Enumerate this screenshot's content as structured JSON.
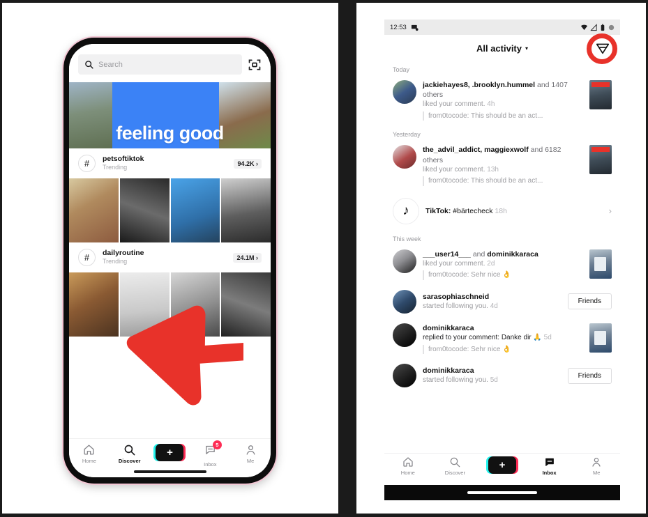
{
  "left_phone": {
    "search": {
      "placeholder": "Search",
      "icon": "search-icon",
      "scan_icon": "scan-qr-icon"
    },
    "banner": {
      "text": "feeling good"
    },
    "trending": [
      {
        "hash": "#",
        "name": "petsoftiktok",
        "subtitle": "Trending",
        "count": "94.2K",
        "chevron": "›"
      },
      {
        "hash": "#",
        "name": "dailyroutine",
        "subtitle": "Trending",
        "count": "24.1M",
        "chevron": "›"
      }
    ],
    "tabbar": [
      {
        "label": "Home",
        "icon": "home-icon",
        "active": false
      },
      {
        "label": "Discover",
        "icon": "search-icon",
        "active": false
      },
      {
        "label": "",
        "icon": "create-plus-icon",
        "active": false,
        "plus": "+"
      },
      {
        "label": "Inbox",
        "icon": "inbox-icon",
        "active": false,
        "badge": "5"
      },
      {
        "label": "Me",
        "icon": "person-icon",
        "active": false
      }
    ]
  },
  "annotations": {
    "arrow_color": "#e8322a",
    "circle_color": "#e8322a",
    "arrow_name": "red-arrow-pointing-down-left",
    "circle_name": "red-circle-highlight-send-icon"
  },
  "right_phone": {
    "statusbar": {
      "time": "12:53",
      "cast_icon": "screen-cast-icon",
      "wifi_icon": "wifi-icon",
      "signal_icon": "signal-icon",
      "battery_icon": "battery-icon"
    },
    "header": {
      "title": "All activity",
      "caret": "▾",
      "send_icon": "send-paper-plane-icon"
    },
    "sections": [
      {
        "label": "Today",
        "items": [
          {
            "type": "like",
            "avatar": "av1",
            "users": "jackiehayes8, .brooklyn.hummel",
            "and_text": " and 1407 others",
            "action": "liked your comment.",
            "time": "4h",
            "quote": "from0tocode: This should be an act...",
            "thumb": "red"
          }
        ]
      },
      {
        "label": "Yesterday",
        "items": [
          {
            "type": "like",
            "avatar": "av2",
            "users": "the_advil_addict, maggiexwolf",
            "and_text": " and 6182 others",
            "action": "liked your comment.",
            "time": "13h",
            "quote": "from0tocode: This should be an act...",
            "thumb": "red"
          },
          {
            "type": "tiktok",
            "avatar": "tiktok-logo",
            "bold": "TikTok:",
            "rest": " #bärtecheck",
            "time": "18h",
            "chevron": "›"
          }
        ]
      },
      {
        "label": "This week",
        "items": [
          {
            "type": "like",
            "avatar": "av4",
            "users": "___user14___",
            "and_text": " and ",
            "users2": "dominikkaraca",
            "action": "liked your comment.",
            "time": "2d",
            "quote": "from0tocode: Sehr nice 👌",
            "thumb": "book"
          },
          {
            "type": "follow",
            "avatar": "av5",
            "users": "sarasophiaschneid",
            "action": "started following you.",
            "time": "4d",
            "button": "Friends"
          },
          {
            "type": "reply",
            "avatar": "av6",
            "users": "dominikkaraca",
            "action": "replied to your comment: Danke dir 🙏",
            "time": "5d",
            "quote": "from0tocode: Sehr nice 👌",
            "thumb": "book"
          },
          {
            "type": "follow",
            "avatar": "av6",
            "users": "dominikkaraca",
            "action": "started following you.",
            "time": "5d",
            "button": "Friends"
          }
        ]
      }
    ],
    "tabbar": [
      {
        "label": "Home",
        "icon": "home-icon",
        "active": false
      },
      {
        "label": "Discover",
        "icon": "search-icon",
        "active": false
      },
      {
        "label": "",
        "icon": "create-plus-icon",
        "active": false,
        "plus": "+"
      },
      {
        "label": "Inbox",
        "icon": "inbox-icon",
        "active": true
      },
      {
        "label": "Me",
        "icon": "person-icon",
        "active": false
      }
    ]
  }
}
